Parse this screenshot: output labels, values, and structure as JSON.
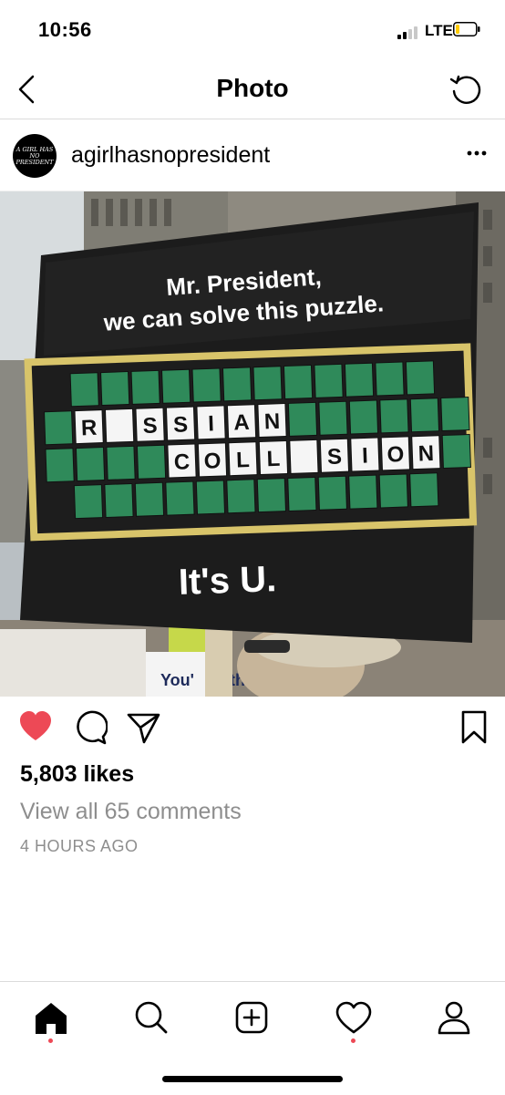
{
  "status_bar": {
    "time": "10:56",
    "network": "LTE"
  },
  "nav": {
    "title": "Photo"
  },
  "post": {
    "avatar_text": "A GIRL HAS NO PRESIDENT",
    "username": "agirlhasnopresident",
    "photo": {
      "sign_title_line1": "Mr. President,",
      "sign_title_line2": "we can solve this puzzle.",
      "puzzle_row1": [
        "R",
        "",
        "S",
        "S",
        "I",
        "A",
        "N"
      ],
      "puzzle_row2": [
        "C",
        "O",
        "L",
        "L",
        "",
        "S",
        "I",
        "O",
        "N"
      ],
      "sign_answer": "It's U.",
      "background_sign_text1": "You'",
      "background_sign_text2": "th"
    },
    "likes": "5,803 likes",
    "view_comments": "View all 65 comments",
    "time_ago": "4 HOURS AGO",
    "liked": true
  },
  "icons": {
    "back": "chevron-left-icon",
    "refresh": "refresh-icon",
    "more": "more-icon",
    "like": "heart-icon",
    "comment": "comment-icon",
    "share": "share-icon",
    "save": "bookmark-icon"
  },
  "tabs": [
    "home",
    "search",
    "add",
    "activity",
    "profile"
  ],
  "colors": {
    "like": "#ed4956",
    "secondary_text": "#8e8e8e",
    "divider": "#dbdbdb"
  }
}
